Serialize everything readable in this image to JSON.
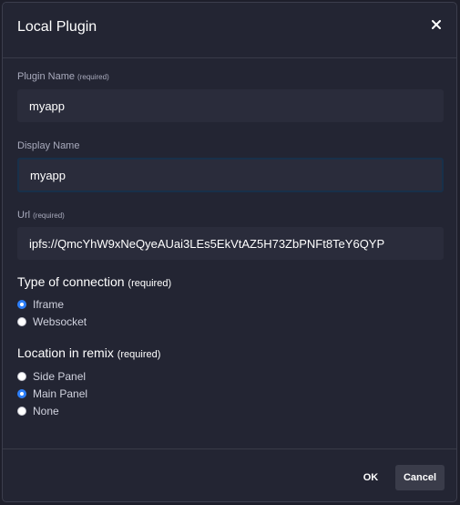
{
  "modal": {
    "title": "Local Plugin",
    "close_icon": "close-icon"
  },
  "fields": {
    "plugin_name": {
      "label": "Plugin Name",
      "req": "(required)",
      "value": "myapp"
    },
    "display_name": {
      "label": "Display Name",
      "value": "myapp"
    },
    "url": {
      "label": "Url",
      "req": "(required)",
      "value": "ipfs://QmcYhW9xNeQyeAUai3LEs5EkVtAZ5H73ZbPNFt8TeY6QYP"
    }
  },
  "connection": {
    "title": "Type of connection",
    "req": "(required)",
    "options": [
      "Iframe",
      "Websocket"
    ],
    "selected": "Iframe"
  },
  "location": {
    "title": "Location in remix",
    "req": "(required)",
    "options": [
      "Side Panel",
      "Main Panel",
      "None"
    ],
    "selected": "Main Panel"
  },
  "footer": {
    "ok_label": "OK",
    "cancel_label": "Cancel"
  },
  "colors": {
    "background": "#232533",
    "input": "#2a2c3b",
    "accent": "#2d7ff9"
  }
}
